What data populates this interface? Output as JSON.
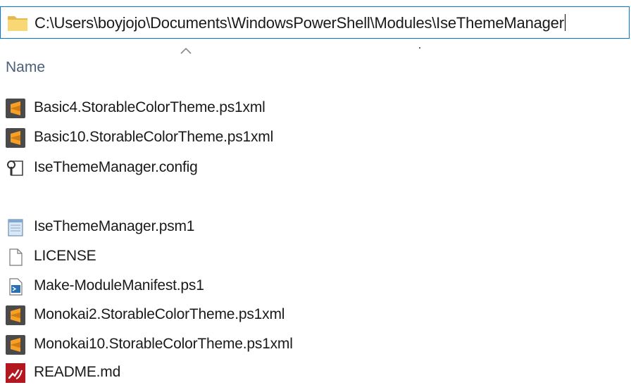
{
  "address_bar": {
    "path": "C:\\Users\\boyjojo\\Documents\\WindowsPowerShell\\Modules\\IseThemeManager"
  },
  "column_header": {
    "name_label": "Name",
    "sort": "ascending"
  },
  "files": [
    {
      "name": "Basic4.StorableColorTheme.ps1xml",
      "icon": "sublime-text-icon"
    },
    {
      "name": "Basic10.StorableColorTheme.ps1xml",
      "icon": "sublime-text-icon"
    },
    {
      "name": "IseThemeManager.config",
      "icon": "config-file-icon"
    },
    {
      "name": "IseThemeManager.psm1",
      "icon": "notepad-file-icon"
    },
    {
      "name": "LICENSE",
      "icon": "blank-file-icon"
    },
    {
      "name": "Make-ModuleManifest.ps1",
      "icon": "powershell-script-icon"
    },
    {
      "name": "Monokai2.StorableColorTheme.ps1xml",
      "icon": "sublime-text-icon"
    },
    {
      "name": "Monokai10.StorableColorTheme.ps1xml",
      "icon": "sublime-text-icon"
    },
    {
      "name": "README.md",
      "icon": "markdown-file-icon"
    }
  ]
}
